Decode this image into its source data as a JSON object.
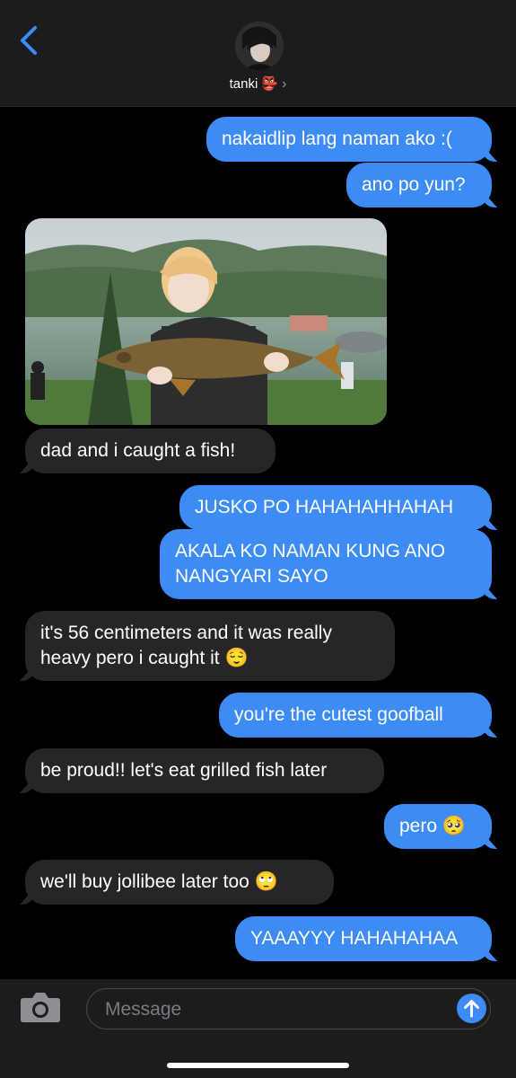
{
  "header": {
    "contact_name": "tanki",
    "contact_emoji": "👺",
    "chevron": "›"
  },
  "messages": [
    {
      "from": "me",
      "text": "nakaidlip lang naman ako :("
    },
    {
      "from": "me",
      "text": "ano po yun?"
    },
    {
      "from": "them",
      "type": "photo",
      "description_icon": "photo-fish"
    },
    {
      "from": "them",
      "text": "dad and i caught a fish!"
    },
    {
      "from": "me",
      "text": "JUSKO PO HAHAHAHHAHAH"
    },
    {
      "from": "me",
      "text": "AKALA KO NAMAN KUNG ANO\nNANGYARI SAYO"
    },
    {
      "from": "them",
      "text": "it's 56 centimeters and it was really\nheavy pero i caught it 😌"
    },
    {
      "from": "me",
      "text": "you're the cutest goofball"
    },
    {
      "from": "them",
      "text": "be proud!! let's eat grilled fish later"
    },
    {
      "from": "me",
      "text": "pero 🥺"
    },
    {
      "from": "them",
      "text": "we'll buy jollibee later too 🙄"
    },
    {
      "from": "me",
      "text": "YAAAYYY HAHAHAHAA"
    }
  ],
  "input": {
    "placeholder": "Message"
  },
  "icons": {
    "back": "chevron-left-icon",
    "camera": "camera-icon",
    "send": "arrow-up-icon"
  },
  "colors": {
    "accent": "#3d8bf5",
    "incoming": "#262628",
    "background": "#000000",
    "header": "#1c1c1e"
  }
}
